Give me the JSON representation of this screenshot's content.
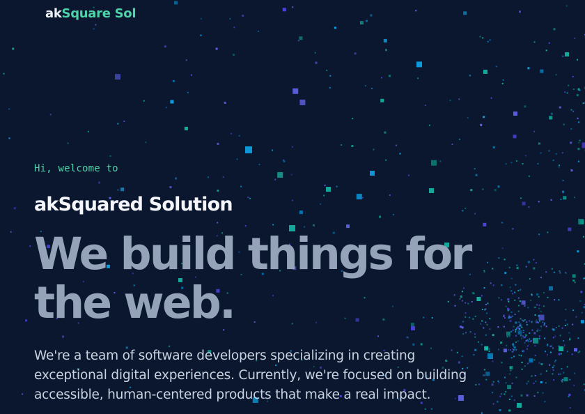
{
  "header": {
    "logo_ak": "ak",
    "logo_rest": "Square Sol"
  },
  "hero": {
    "greeting": "Hi, welcome to",
    "company_name": "akSquared Solution",
    "headline_lines": [
      "We build things for",
      "the web."
    ],
    "intro_lines": [
      "We're a team of software developers specializing in creating",
      "exceptional digital experiences. Currently, we're focused on building",
      "accessible, human-centered products that make a real impact."
    ]
  },
  "theme": {
    "background": "#0b172e",
    "accent": "#4fd1a9",
    "headline_color": "#94a3b8",
    "particle_colors": [
      "#14b8a6",
      "#0d9488",
      "#0ea5e9",
      "#0284c7",
      "#6366f1",
      "#4f46e5"
    ]
  }
}
